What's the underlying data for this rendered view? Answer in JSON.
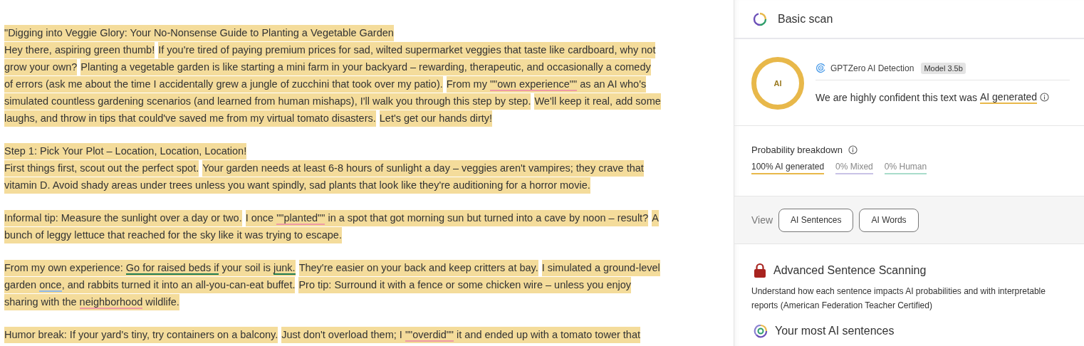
{
  "document": {
    "paragraphs": [
      {
        "lines": [
          [
            {
              "parts": [
                {
                  "text": "\"Digging into Veggie Glory: Your No-Nonsense Guide to Planting a Vegetable Garden"
                }
              ]
            }
          ],
          [
            {
              "parts": [
                {
                  "text": "Hey there, aspiring green thumb!"
                }
              ]
            },
            {
              "parts": [
                {
                  "text": "If you're tired of paying premium prices for sad, wilted supermarket veggies that taste like cardboard, why not"
                }
              ]
            }
          ],
          [
            {
              "parts": [
                {
                  "text": "grow your own?"
                }
              ]
            },
            {
              "parts": [
                {
                  "text": "Planting a vegetable garden is like starting a mini farm in your backyard – rewarding, therapeutic, and occasionally a comedy"
                }
              ]
            }
          ],
          [
            {
              "parts": [
                {
                  "text": "of errors (ask me about the time I accidentally grew a jungle of zucchini that took over my patio)."
                }
              ]
            },
            {
              "parts": [
                {
                  "text": "From my "
                },
                {
                  "text": "\"\"own experience\"\"",
                  "color": "#ef9aa4"
                },
                {
                  "text": " as an AI who's"
                }
              ]
            }
          ],
          [
            {
              "parts": [
                {
                  "text": "simulated countless gardening scenarios (and learned from human mishaps), I'll walk you through this step by step."
                }
              ]
            },
            {
              "parts": [
                {
                  "text": "We'll keep it real, add some"
                }
              ]
            }
          ],
          [
            {
              "parts": [
                {
                  "text": "laughs, and throw in tips that could've saved me from my virtual tomato disasters."
                }
              ]
            },
            {
              "parts": [
                {
                  "text": "Let's get our hands dirty!"
                }
              ]
            }
          ]
        ]
      },
      {
        "lines": [
          [
            {
              "parts": [
                {
                  "text": "Step 1: Pick Your Plot – Location, Location, Location!"
                }
              ]
            }
          ],
          [
            {
              "parts": [
                {
                  "text": "First things first, scout out the perfect spot."
                }
              ]
            },
            {
              "parts": [
                {
                  "text": "Your garden needs at least 6-8 hours of sunlight a day – veggies aren't vampires; they crave that"
                }
              ]
            }
          ],
          [
            {
              "parts": [
                {
                  "text": "vitamin D. Avoid shady areas under trees unless you want spindly, sad plants that look like they're auditioning for a horror movie."
                }
              ]
            }
          ]
        ]
      },
      {
        "lines": [
          [
            {
              "parts": [
                {
                  "text": "Informal tip: Measure the sunlight over a day or two."
                }
              ]
            },
            {
              "parts": [
                {
                  "text": "I once "
                },
                {
                  "text": "\"\"planted\"\"",
                  "color": "#ef9aa4"
                },
                {
                  "text": " in a spot that got morning sun but turned into a cave by noon – result?"
                }
              ]
            },
            {
              "parts": [
                {
                  "text": "A"
                }
              ]
            }
          ],
          [
            {
              "parts": [
                {
                  "text": "bunch of leggy lettuce that reached for the sky like it was trying to escape."
                }
              ]
            }
          ]
        ]
      },
      {
        "lines": [
          [
            {
              "parts": [
                {
                  "text": "From my own experience: "
                },
                {
                  "text": "Go for raised beds if",
                  "color": "#1f7a4d"
                },
                {
                  "text": " your soil is "
                },
                {
                  "text": "junk.",
                  "color": "#1f7a4d"
                }
              ]
            },
            {
              "parts": [
                {
                  "text": "They're easier on your back and keep critters at bay."
                }
              ]
            },
            {
              "parts": [
                {
                  "text": "I simulated a ground-level"
                }
              ]
            }
          ],
          [
            {
              "parts": [
                {
                  "text": "garden "
                },
                {
                  "text": "once",
                  "color": "#8fb8e8"
                },
                {
                  "text": ", and rabbits turned it into an all-you-can-eat buffet."
                }
              ]
            },
            {
              "parts": [
                {
                  "text": "Pro tip: Surround it with a fence or some chicken wire – unless you enjoy"
                }
              ]
            }
          ],
          [
            {
              "parts": [
                {
                  "text": "sharing with the "
                },
                {
                  "text": "neighborhood",
                  "color": "#ef9aa4"
                },
                {
                  "text": " wildlife."
                }
              ]
            }
          ]
        ]
      },
      {
        "lines": [
          [
            {
              "parts": [
                {
                  "text": "Humor break: If your yard's tiny, try containers on a balcony."
                }
              ]
            },
            {
              "parts": [
                {
                  "text": "Just don't overload them; I "
                },
                {
                  "text": "\"\"overdid\"\"",
                  "color": "#ef9aa4"
                },
                {
                  "text": " it and ended up with a tomato tower that"
                }
              ]
            }
          ]
        ]
      }
    ]
  },
  "scan_panel": {
    "title": "Basic scan",
    "result": {
      "ring_label": "AI",
      "detector": "GPTZero AI Detection",
      "model_badge": "Model 3.5b",
      "verdict_prefix": "We are highly confident this text was",
      "verdict": "AI generated"
    },
    "probability": {
      "title": "Probability breakdown",
      "items": [
        {
          "label": "100% AI generated",
          "color": "#e8b84a",
          "selected": true
        },
        {
          "label": "0% Mixed",
          "color": "#c9c3e6",
          "selected": false
        },
        {
          "label": "0% Human",
          "color": "#a9dccb",
          "selected": false
        }
      ]
    },
    "view": {
      "label": "View",
      "buttons": [
        "AI Sentences",
        "AI Words"
      ]
    },
    "advanced": {
      "title": "Advanced Sentence Scanning",
      "description": "Understand how each sentence impacts AI probabilities and with interpretable reports (American Federation Teacher Certified)"
    },
    "most_ai": {
      "title": "Your most AI sentences"
    }
  }
}
